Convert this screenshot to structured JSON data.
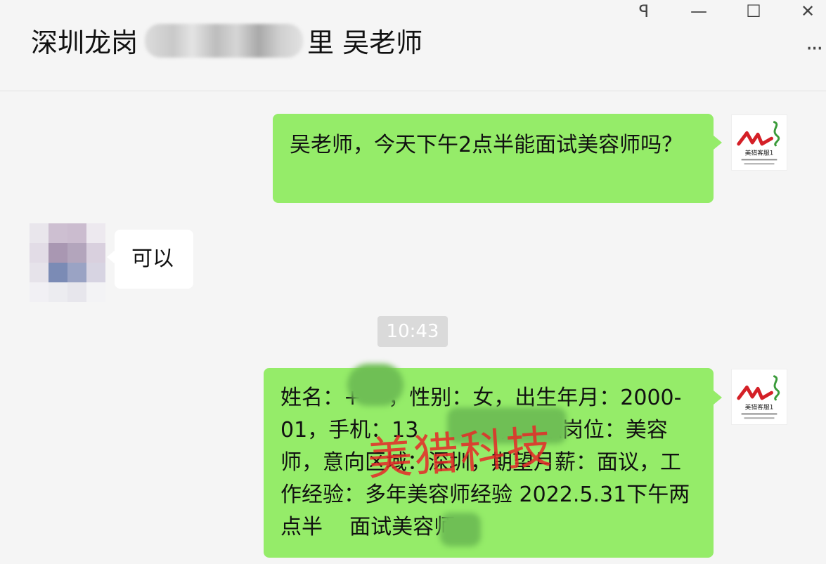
{
  "window": {
    "pin_icon": "pin-icon",
    "minimize_icon": "minimize-icon",
    "maximize_icon": "maximize-icon",
    "close_icon": "close-icon",
    "pin_glyph": "ꟼ",
    "minimize_glyph": "—",
    "maximize_glyph": "☐",
    "close_glyph": "✕"
  },
  "header": {
    "title_prefix": "深圳龙岗",
    "title_suffix": "里 吴老师",
    "more_label": "···"
  },
  "messages": [
    {
      "side": "right",
      "text": "吴老师，今天下午2点半能面试美容师吗？"
    },
    {
      "side": "left",
      "text": "可以"
    },
    {
      "side": "right",
      "text": "姓名：+    ，性别：女，出生年月：2000-01，手机：13        45，求职岗位：美容师，意向区域：深圳，期望月薪：面议，工作经验：多年美容师经验 2022.5.31下午两点半    面试美容师"
    }
  ],
  "timestamp": "10:43",
  "watermark": "美猎科技",
  "logo": {
    "caption": "美猎客服1"
  },
  "colors": {
    "green_bubble": "#95ec69",
    "white_bubble": "#ffffff",
    "watermark": "#e62828",
    "logo_red": "#d42027",
    "logo_green": "#3a9b3a"
  }
}
